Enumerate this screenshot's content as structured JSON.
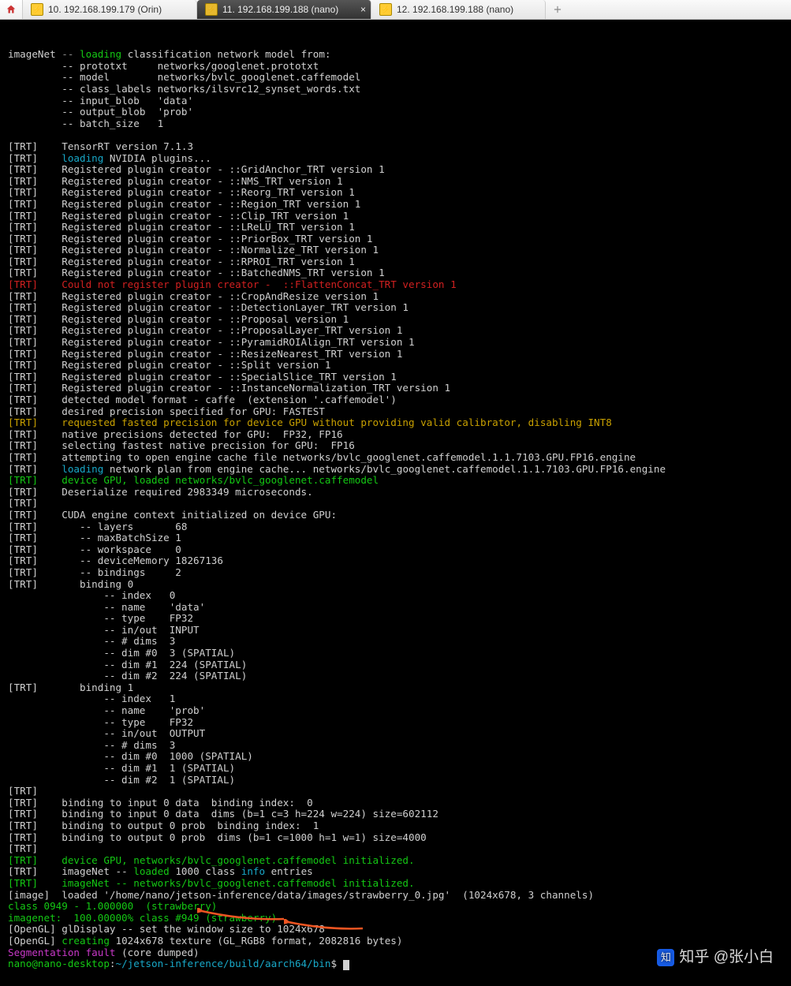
{
  "tabs": {
    "t0": {
      "label": "10. 192.168.199.179 (Orin)"
    },
    "t1": {
      "label": "11. 192.168.199.188 (nano)"
    },
    "t2": {
      "label": "12. 192.168.199.188 (nano)"
    }
  },
  "header": {
    "title": "imageNet",
    "loading": "loading",
    "rest": "classification network model from:",
    "p1": "-- prototxt     networks/googlenet.prototxt",
    "p2": "-- model        networks/bvlc_googlenet.caffemodel",
    "p3": "-- class_labels networks/ilsvrc12_synset_words.txt",
    "p4": "-- input_blob   'data'",
    "p5": "-- output_blob  'prob'",
    "p6": "-- batch_size   1"
  },
  "trt": {
    "ver": "TensorRT version 7.1.3",
    "loadplug": "NVIDIA plugins...",
    "regs": [
      "Registered plugin creator - ::GridAnchor_TRT version 1",
      "Registered plugin creator - ::NMS_TRT version 1",
      "Registered plugin creator - ::Reorg_TRT version 1",
      "Registered plugin creator - ::Region_TRT version 1",
      "Registered plugin creator - ::Clip_TRT version 1",
      "Registered plugin creator - ::LReLU_TRT version 1",
      "Registered plugin creator - ::PriorBox_TRT version 1",
      "Registered plugin creator - ::Normalize_TRT version 1",
      "Registered plugin creator - ::RPROI_TRT version 1",
      "Registered plugin creator - ::BatchedNMS_TRT version 1"
    ],
    "err": "Could not register plugin creator -  ::FlattenConcat_TRT version 1",
    "regs2": [
      "Registered plugin creator - ::CropAndResize version 1",
      "Registered plugin creator - ::DetectionLayer_TRT version 1",
      "Registered plugin creator - ::Proposal version 1",
      "Registered plugin creator - ::ProposalLayer_TRT version 1",
      "Registered plugin creator - ::PyramidROIAlign_TRT version 1",
      "Registered plugin creator - ::ResizeNearest_TRT version 1",
      "Registered plugin creator - ::Split version 1",
      "Registered plugin creator - ::SpecialSlice_TRT version 1",
      "Registered plugin creator - ::InstanceNormalization_TRT version 1"
    ],
    "fmt": "detected model format - caffe  (extension '.caffemodel')",
    "prec": "desired precision specified for GPU: FASTEST",
    "warn": "requested fasted precision for device GPU without providing valid calibrator, disabling INT8",
    "nat": "native precisions detected for GPU:  FP32, FP16",
    "sel": "selecting fastest native precision for GPU:  FP16",
    "att": "attempting to open engine cache file networks/bvlc_googlenet.caffemodel.1.1.7103.GPU.FP16.engine",
    "loadplan": "network plan from engine cache... networks/bvlc_googlenet.caffemodel.1.1.7103.GPU.FP16.engine",
    "devload": "device GPU, loaded networks/bvlc_googlenet.caffemodel",
    "deser": "Deserialize required 2983349 microseconds.",
    "cuda": "CUDA engine context initialized on device GPU:",
    "lay": "   -- layers       68",
    "mbs": "   -- maxBatchSize 1",
    "ws": "   -- workspace    0",
    "dm": "   -- deviceMemory 18267136",
    "bd": "   -- bindings     2",
    "b0": "   binding 0",
    "b0i": "                -- index   0",
    "b0n": "                -- name    'data'",
    "b0t": "                -- type    FP32",
    "b0o": "                -- in/out  INPUT",
    "b0d": "                -- # dims  3",
    "b0d0": "                -- dim #0  3 (SPATIAL)",
    "b0d1": "                -- dim #1  224 (SPATIAL)",
    "b0d2": "                -- dim #2  224 (SPATIAL)",
    "b1": "   binding 1",
    "b1i": "                -- index   1",
    "b1n": "                -- name    'prob'",
    "b1t": "                -- type    FP32",
    "b1o": "                -- in/out  OUTPUT",
    "b1d": "                -- # dims  3",
    "b1d0": "                -- dim #0  1000 (SPATIAL)",
    "b1d1": "                -- dim #1  1 (SPATIAL)",
    "b1d2": "                -- dim #2  1 (SPATIAL)",
    "bind0a": "binding to input 0 data  binding index:  0",
    "bind0b": "binding to input 0 data  dims (b=1 c=3 h=224 w=224) size=602112",
    "bind1a": "binding to output 0 prob  binding index:  1",
    "bind1b": "binding to output 0 prob  dims (b=1 c=1000 h=1 w=1) size=4000",
    "init1": "device GPU, networks/bvlc_googlenet.caffemodel initialized.",
    "imgnet1a": "imageNet -- ",
    "imgnet1b": "loaded ",
    "imgnet1c": "1000 ",
    "imgnet1d": "class ",
    "imgnet1e": "info ",
    "imgnet1f": "entries",
    "init2": "imageNet -- networks/bvlc_googlenet.caffemodel initialized."
  },
  "image": {
    "line": "[image]  loaded '/home/nano/jetson-inference/data/images/strawberry_0.jpg'  (1024x678, 3 channels)",
    "class": "class 0949 - 1.000000  (strawberry)",
    "net": "imagenet:  100.00000% class #949 (strawberry)"
  },
  "gl": {
    "disp": "[OpenGL] glDisplay -- set the window size to 1024x678",
    "tex1": "[OpenGL] ",
    "tex2": "creating ",
    "tex3": "1024x678 texture (GL_RGB8 format, 2082816 bytes)"
  },
  "seg": {
    "a": "Segmentation fault",
    "b": " (core dumped)"
  },
  "prompt": {
    "user": "nano@nano-desktop",
    "path": "~/jetson-inference/build/aarch64/bin",
    "sym": "$"
  },
  "watermark": "知乎 @张小白"
}
